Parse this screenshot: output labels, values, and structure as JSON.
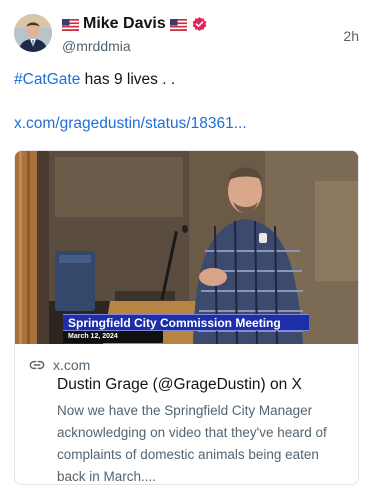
{
  "author": {
    "display_name": "Mike Davis",
    "handle": "@mrddmia",
    "time": "2h",
    "flag_icon": "us-flag-icon",
    "verified_icon": "verified-badge-icon",
    "verified_color": "#e0245e"
  },
  "post": {
    "hashtag": "#CatGate",
    "text": " has 9 lives . .",
    "link": "x.com/gragedustin/status/18361..."
  },
  "card": {
    "video_caption_title": "Springfield City Commission Meeting",
    "video_caption_date": "March 12, 2024",
    "domain": "x.com",
    "title": "Dustin Grage (@GrageDustin) on X",
    "description": "Now we have the Springfield City Manager acknowledging on video that they've heard of complaints of domestic animals being eaten back in March...."
  },
  "colors": {
    "link": "#1d6fd8",
    "caption_bar": "#1e2ea8"
  }
}
